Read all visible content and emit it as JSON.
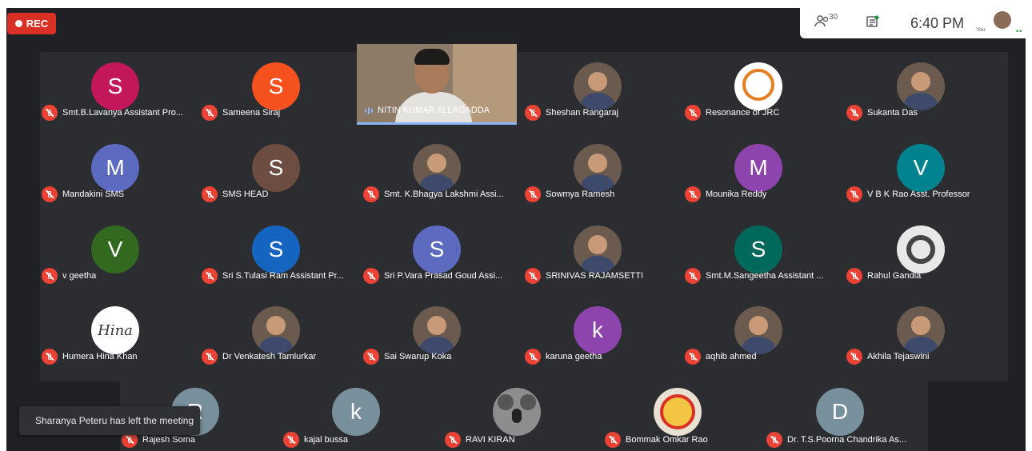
{
  "recording": {
    "label": "REC"
  },
  "topbar": {
    "participant_count": "30",
    "time": "6:40 PM",
    "you_label": "You",
    "more_indicator": "••"
  },
  "video_tile": {
    "name": "NITIN KUMAR ALLAGADDA"
  },
  "participants": [
    {
      "name": "Smt.B.Lavanya Assistant Pro...",
      "initial": "S",
      "color": "#c2185b"
    },
    {
      "name": "Sameena Siraj",
      "initial": "S",
      "color": "#f4511e"
    },
    {
      "name": "Sheshan Rangaraj",
      "initial": "",
      "color": ""
    },
    {
      "name": "Resonance of JRC",
      "initial": "",
      "color": ""
    },
    {
      "name": "Sukanta Das",
      "initial": "",
      "color": ""
    },
    {
      "name": "Mandakini SMS",
      "initial": "M",
      "color": "#5c6bc0"
    },
    {
      "name": "SMS HEAD",
      "initial": "S",
      "color": "#6d4c41"
    },
    {
      "name": "Smt. K.Bhagya Lakshmi Assi...",
      "initial": "",
      "color": ""
    },
    {
      "name": "Sowmya Ramesh",
      "initial": "",
      "color": ""
    },
    {
      "name": "Mounika Reddy",
      "initial": "M",
      "color": "#8e44ad"
    },
    {
      "name": "V B K Rao Asst. Professor",
      "initial": "V",
      "color": "#00838f"
    },
    {
      "name": "v geetha",
      "initial": "V",
      "color": "#33691e"
    },
    {
      "name": "Sri S.Tulasi Ram Assistant Pr...",
      "initial": "S",
      "color": "#1565c0"
    },
    {
      "name": "Sri P.Vara Prasad Goud Assi...",
      "initial": "S",
      "color": "#5c6bc0"
    },
    {
      "name": "SRINIVAS RAJAMSETTI",
      "initial": "",
      "color": ""
    },
    {
      "name": "Smt.M.Sangeetha Assistant ...",
      "initial": "S",
      "color": "#00695c"
    },
    {
      "name": "Rahul Gandla",
      "initial": "",
      "color": ""
    },
    {
      "name": "Humera Hina Khan",
      "initial": "Hina",
      "color": ""
    },
    {
      "name": "Dr Venkatesh Tamlurkar",
      "initial": "",
      "color": ""
    },
    {
      "name": "Sai Swarup Koka",
      "initial": "",
      "color": ""
    },
    {
      "name": "karuna geetha",
      "initial": "k",
      "color": "#8e44ad"
    },
    {
      "name": "aqhib ahmed",
      "initial": "",
      "color": ""
    },
    {
      "name": "Akhila Tejaswini",
      "initial": "",
      "color": ""
    },
    {
      "name": "Rajesh Soma",
      "initial": "R",
      "color": "#78909c"
    },
    {
      "name": "kajal bussa",
      "initial": "k",
      "color": "#78909c"
    },
    {
      "name": "RAVI KIRAN",
      "initial": "",
      "color": ""
    },
    {
      "name": "Bommak Omkar Rao",
      "initial": "",
      "color": ""
    },
    {
      "name": "Dr. T.S.Poorna Chandrika As...",
      "initial": "D",
      "color": "#78909c"
    }
  ],
  "toast": {
    "message": "Sharanya Peteru has left the meeting"
  },
  "icons": [
    "people-icon",
    "chat-icon",
    "record-icon",
    "mic-off-icon",
    "speaking-icon"
  ]
}
